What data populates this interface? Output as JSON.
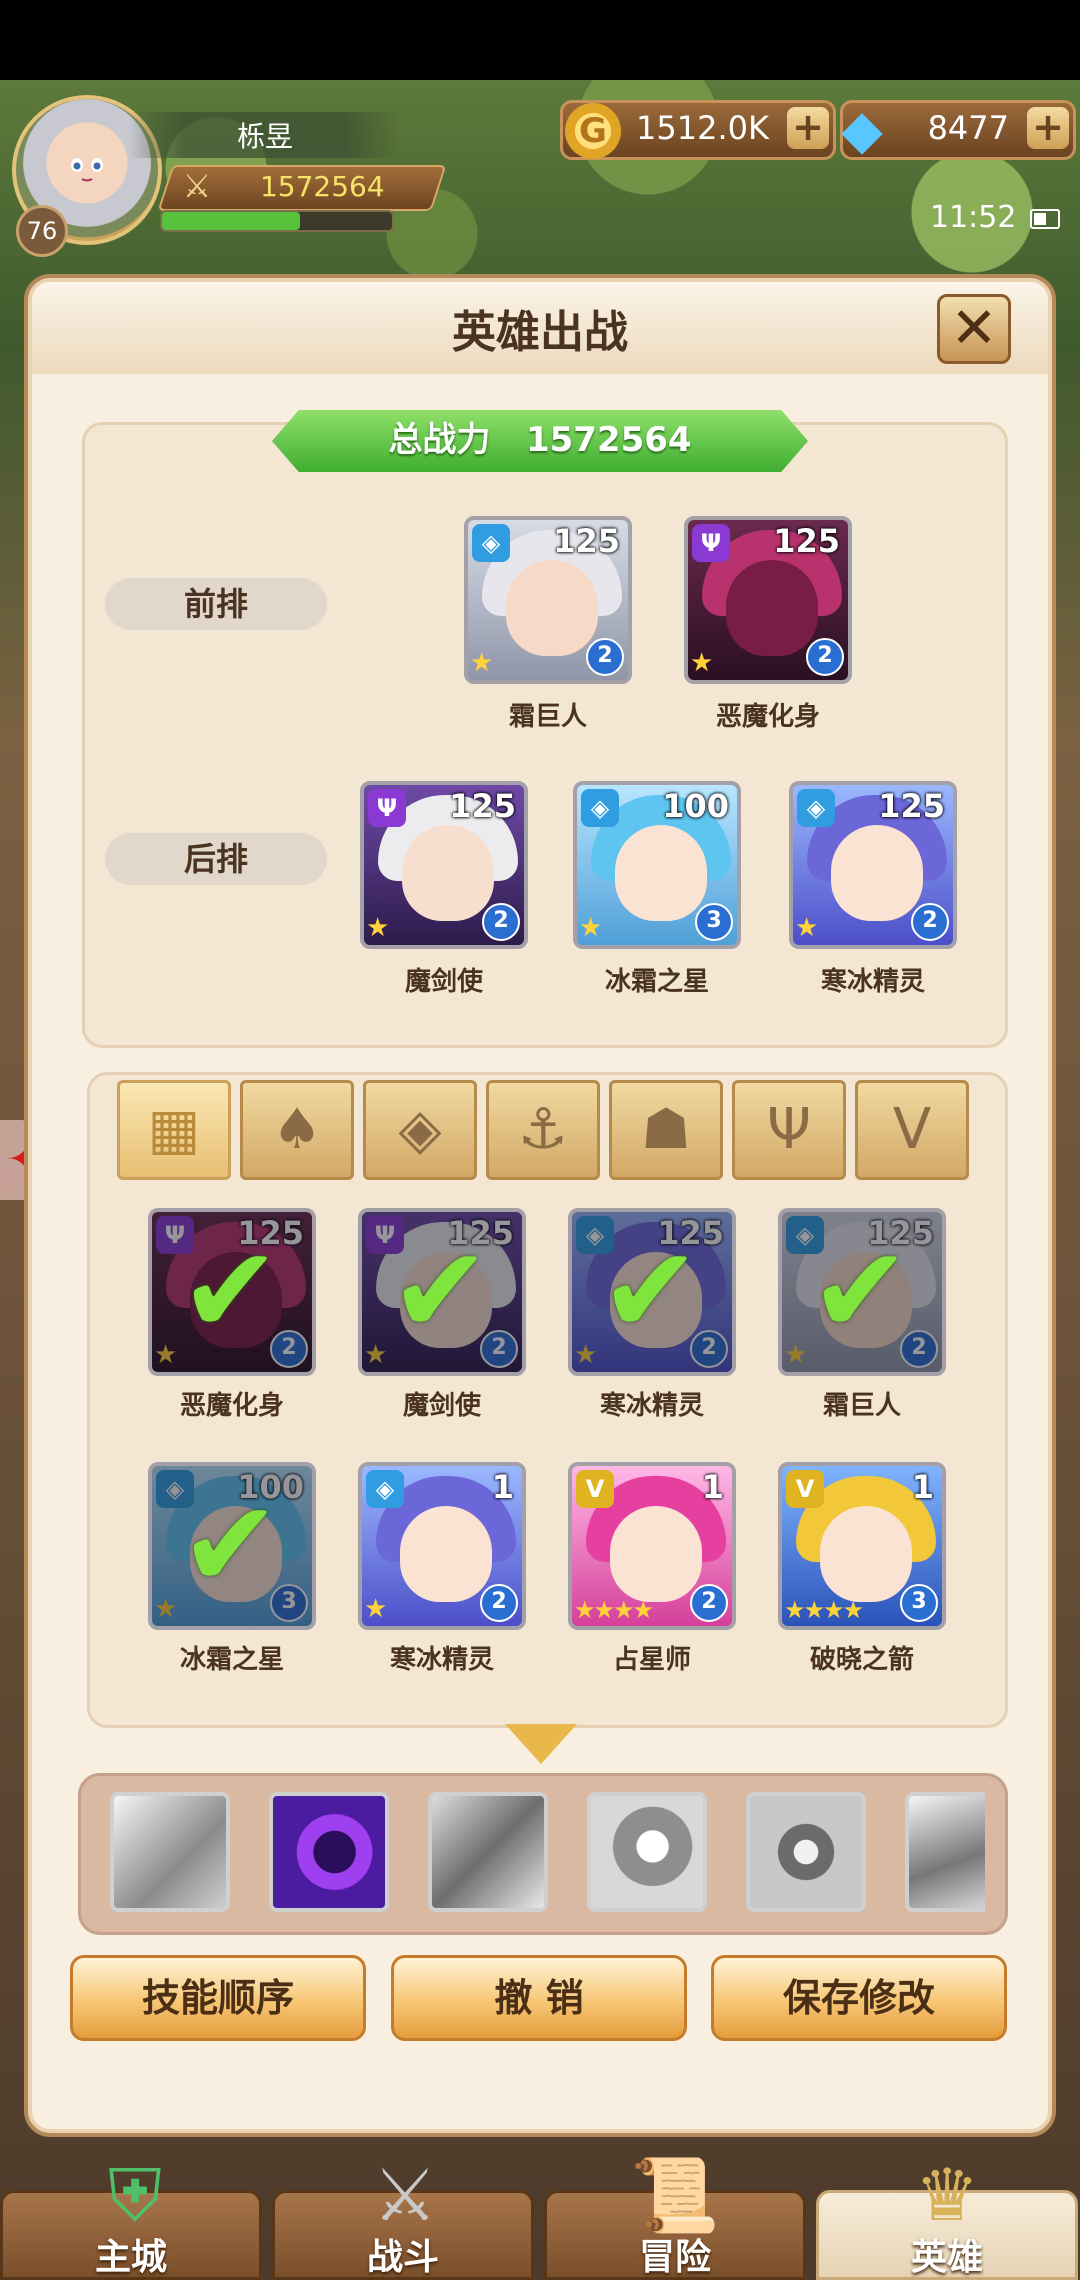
{
  "player": {
    "name": "栎昱",
    "power": "1572564",
    "level": "76",
    "xp_fraction": 0.6
  },
  "resources": {
    "gold": "1512.0K",
    "gems": "8477"
  },
  "status": {
    "time": "11:52"
  },
  "panel": {
    "title": "英雄出战",
    "total_power_label": "总战力",
    "total_power": "1572564",
    "front_row_label": "前排",
    "back_row_label": "后排"
  },
  "front_row": [
    {
      "name": "霜巨人",
      "level": "125",
      "rank": "2",
      "element": "ice"
    },
    {
      "name": "恶魔化身",
      "level": "125",
      "rank": "2",
      "element": "demon"
    }
  ],
  "back_row": [
    {
      "name": "魔剑使",
      "level": "125",
      "rank": "2",
      "element": "demon"
    },
    {
      "name": "冰霜之星",
      "level": "100",
      "rank": "3",
      "element": "ice"
    },
    {
      "name": "寒冰精灵",
      "level": "125",
      "rank": "2",
      "element": "ice"
    }
  ],
  "filters": [
    "all",
    "nature",
    "ice",
    "anchor",
    "beast",
    "demon",
    "dark"
  ],
  "roster": [
    {
      "name": "恶魔化身",
      "level": "125",
      "rank": "2",
      "selected": true
    },
    {
      "name": "魔剑使",
      "level": "125",
      "rank": "2",
      "selected": true
    },
    {
      "name": "寒冰精灵",
      "level": "125",
      "rank": "2",
      "selected": true
    },
    {
      "name": "霜巨人",
      "level": "125",
      "rank": "2",
      "selected": true
    },
    {
      "name": "冰霜之星",
      "level": "100",
      "rank": "3",
      "selected": true
    },
    {
      "name": "寒冰精灵",
      "level": "1",
      "rank": "2",
      "selected": false
    },
    {
      "name": "占星师",
      "level": "1",
      "rank": "2",
      "selected": false
    },
    {
      "name": "破晓之箭",
      "level": "1",
      "rank": "3",
      "selected": false
    }
  ],
  "buttons": {
    "skill_order": "技能顺序",
    "undo": "撤 销",
    "save": "保存修改"
  },
  "nav": {
    "city": "主城",
    "battle": "战斗",
    "adventure": "冒险",
    "heroes": "英雄"
  },
  "icons": {
    "close": "close-icon",
    "gold": "coin-icon",
    "gem": "gem-icon",
    "plus": "plus-icon"
  }
}
